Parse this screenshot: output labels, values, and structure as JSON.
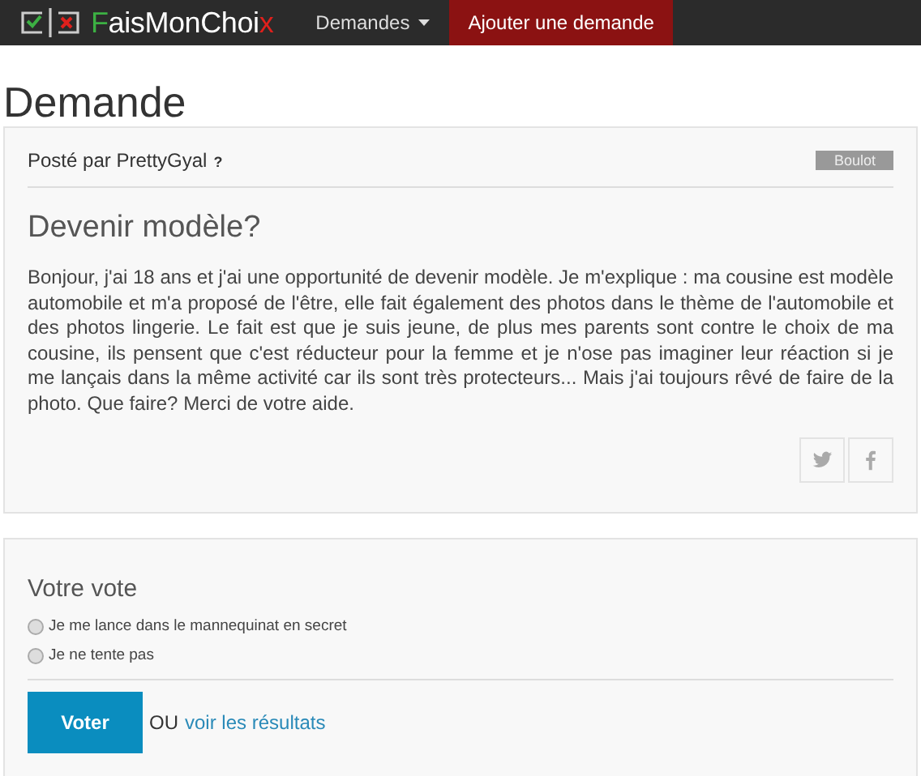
{
  "navbar": {
    "logo": {
      "parts": [
        {
          "text": "F",
          "color": "#3cb043"
        },
        {
          "text": "aisMonChoi",
          "color": "#ffffff"
        },
        {
          "text": "x",
          "color": "#e0201c"
        }
      ]
    },
    "items": [
      {
        "label": "Demandes",
        "kind": "dropdown",
        "selected": false
      },
      {
        "label": "Ajouter une demande",
        "kind": "link",
        "selected": true
      }
    ]
  },
  "page_title": "Demande",
  "post": {
    "author_line": "Posté par PrettyGyal",
    "help_mark": "?",
    "category": "Boulot",
    "title": "Devenir modèle?",
    "body": "Bonjour, j'ai 18 ans et j'ai une opportunité de devenir modèle. Je m'explique : ma cousine est modèle automobile et m'a proposé de l'être, elle fait également des photos dans le thème de l'automobile et des photos lingerie. Le fait est que je suis jeune, de plus mes parents sont contre le choix de ma cousine, ils pensent que c'est réducteur pour la femme et je n'ose pas imaginer leur réaction si je me lançais dans la même activité car ils sont très protecteurs... Mais j'ai toujours rêvé de faire de la photo. Que faire? Merci de votre aide.",
    "share": [
      {
        "kind": "twitter"
      },
      {
        "kind": "facebook"
      }
    ]
  },
  "vote": {
    "title": "Votre vote",
    "options": [
      {
        "label": "Je me lance dans le mannequinat en secret",
        "selected": false
      },
      {
        "label": "Je ne tente pas",
        "selected": false
      }
    ],
    "submit": "Voter",
    "or_text": "OU",
    "results_link": "voir les résultats"
  }
}
